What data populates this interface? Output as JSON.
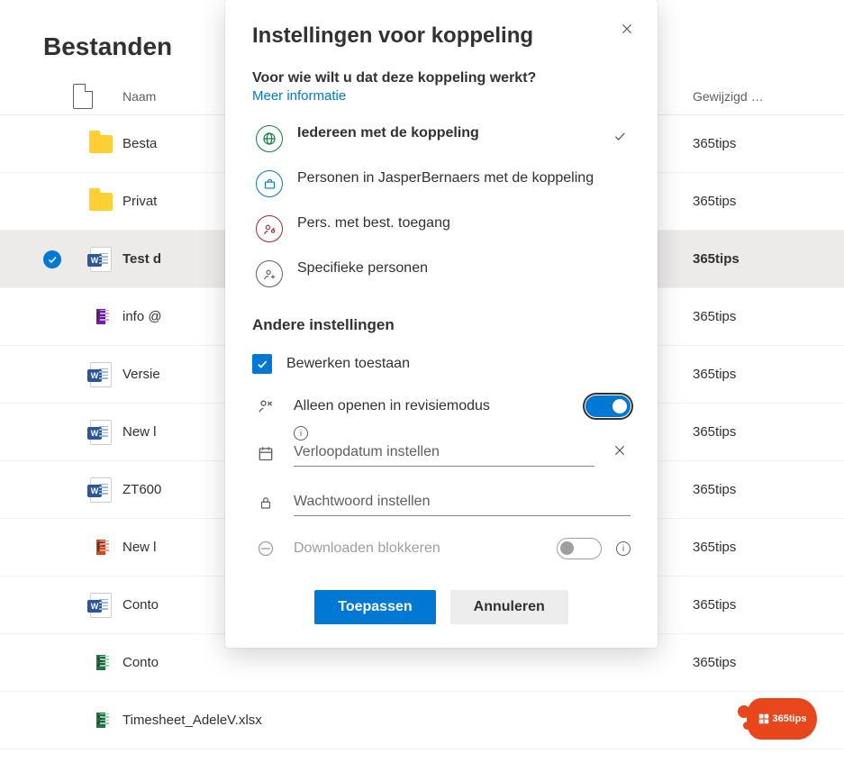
{
  "header": {
    "title": "Bestanden"
  },
  "columns": {
    "name": "Naam",
    "modified": "Gewijzigd …"
  },
  "files": [
    {
      "type": "folder",
      "name": "Besta",
      "modified": "365tips",
      "selected": false
    },
    {
      "type": "folder",
      "name": "Privat",
      "modified": "365tips",
      "selected": false
    },
    {
      "type": "word",
      "name": "Test d",
      "modified": "365tips",
      "selected": true
    },
    {
      "type": "onenote",
      "name": "info @",
      "modified": "365tips",
      "selected": false
    },
    {
      "type": "word",
      "name": "Versie",
      "modified": "365tips",
      "selected": false
    },
    {
      "type": "word",
      "name": "New l",
      "modified": "365tips",
      "selected": false
    },
    {
      "type": "word",
      "name": "ZT600",
      "modified": "365tips",
      "selected": false
    },
    {
      "type": "ppt",
      "name": "New l",
      "modified": "365tips",
      "selected": false
    },
    {
      "type": "word",
      "name": "Conto",
      "modified": "365tips",
      "selected": false
    },
    {
      "type": "xls",
      "name": "Conto",
      "modified": "365tips",
      "selected": false
    },
    {
      "type": "xls",
      "name": "Timesheet_AdeleV.xlsx",
      "modified": "",
      "selected": false
    }
  ],
  "modal": {
    "title": "Instellingen voor koppeling",
    "close": "✕",
    "question": "Voor wie wilt u dat deze koppeling werkt?",
    "learn_more": "Meer informatie",
    "options": {
      "anyone": {
        "label": "Iedereen met de koppeling",
        "selected": true
      },
      "org": {
        "label": "Personen in JasperBernaers met de koppeling",
        "selected": false
      },
      "existing": {
        "label": "Pers. met best. toegang",
        "selected": false
      },
      "specific": {
        "label": "Specifieke personen",
        "selected": false
      }
    },
    "section_other": "Andere instellingen",
    "settings": {
      "allow_edit": {
        "label": "Bewerken toestaan",
        "checked": true
      },
      "review_only": {
        "label": "Alleen openen in revisiemodus",
        "on": true
      },
      "expiry": {
        "placeholder": "Verloopdatum instellen"
      },
      "password": {
        "placeholder": "Wachtwoord instellen"
      },
      "block_dl": {
        "label": "Downloaden blokkeren",
        "on": false
      }
    },
    "actions": {
      "apply": "Toepassen",
      "cancel": "Annuleren"
    }
  },
  "brand": {
    "label": "365tips"
  }
}
